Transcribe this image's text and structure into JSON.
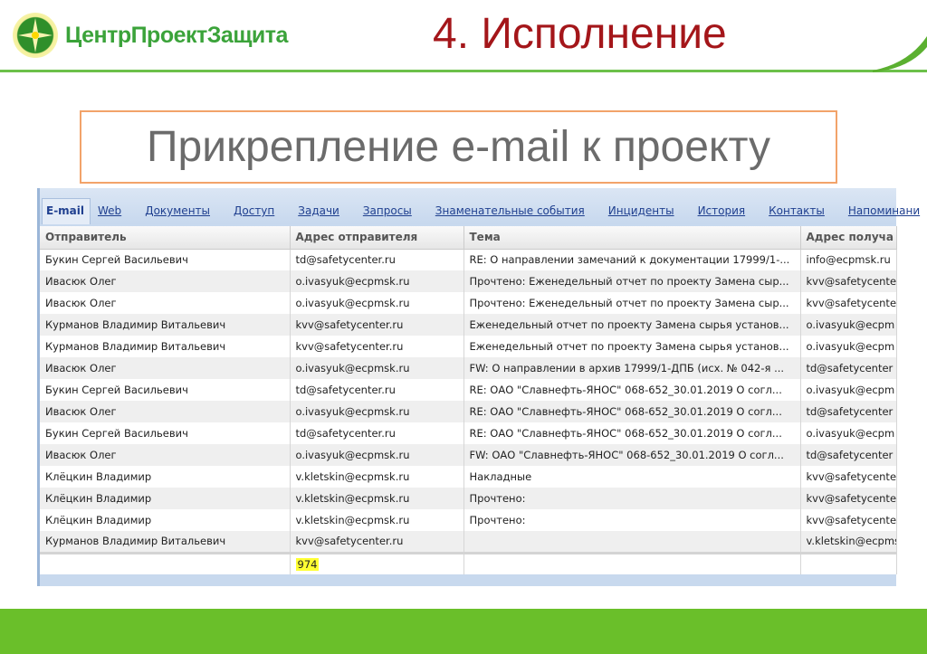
{
  "header": {
    "logo_text": "ЦентрПроектЗащита",
    "slide_title": "4. Исполнение"
  },
  "subtitle": "Прикрепление e-mail к проекту",
  "tabs": [
    "E-mail",
    "Web",
    "Документы",
    "Доступ",
    "Задачи",
    "Запросы",
    "Знаменательные события",
    "Инциденты",
    "История",
    "Контакты",
    "Напоминани"
  ],
  "active_tab": 0,
  "columns": [
    "Отправитель",
    "Адрес отправителя",
    "Тема",
    "Адрес получа"
  ],
  "rows": [
    [
      "Букин Сергей Васильевич",
      "td@safetycenter.ru",
      "RE: О направлении замечаний к документации 17999/1-...",
      "info@ecpmsk.ru"
    ],
    [
      "Ивасюк Олег",
      "o.ivasyuk@ecpmsk.ru",
      "Прочтено: Еженедельный отчет по проекту Замена сыр...",
      "kvv@safetycente"
    ],
    [
      "Ивасюк Олег",
      "o.ivasyuk@ecpmsk.ru",
      "Прочтено: Еженедельный отчет по проекту Замена сыр...",
      "kvv@safetycente"
    ],
    [
      "Курманов Владимир Витальевич",
      "kvv@safetycenter.ru",
      "Еженедельный отчет по проекту Замена сырья установ...",
      "o.ivasyuk@ecpm"
    ],
    [
      "Курманов Владимир Витальевич",
      "kvv@safetycenter.ru",
      "Еженедельный отчет по проекту Замена сырья установ...",
      "o.ivasyuk@ecpm"
    ],
    [
      "Ивасюк Олег",
      "o.ivasyuk@ecpmsk.ru",
      "FW: О направлении в архив 17999/1-ДПБ (исх. № 042-я ...",
      "td@safetycenter"
    ],
    [
      "Букин Сергей Васильевич",
      "td@safetycenter.ru",
      "RE: ОАО \"Славнефть-ЯНОС\" 068-652_30.01.2019 О согл...",
      "o.ivasyuk@ecpm"
    ],
    [
      "Ивасюк Олег",
      "o.ivasyuk@ecpmsk.ru",
      "RE: ОАО \"Славнефть-ЯНОС\" 068-652_30.01.2019 О согл...",
      "td@safetycenter"
    ],
    [
      "Букин Сергей Васильевич",
      "td@safetycenter.ru",
      "RE: ОАО \"Славнефть-ЯНОС\" 068-652_30.01.2019 О согл...",
      "o.ivasyuk@ecpm"
    ],
    [
      "Ивасюк Олег",
      "o.ivasyuk@ecpmsk.ru",
      "FW: ОАО \"Славнефть-ЯНОС\" 068-652_30.01.2019 О согл...",
      "td@safetycenter"
    ],
    [
      "Клёцкин Владимир",
      "v.kletskin@ecpmsk.ru",
      "Накладные",
      "kvv@safetycente"
    ],
    [
      "Клёцкин Владимир",
      "v.kletskin@ecpmsk.ru",
      "Прочтено:",
      "kvv@safetycente"
    ],
    [
      "Клёцкин Владимир",
      "v.kletskin@ecpmsk.ru",
      "Прочтено:",
      "kvv@safetycente"
    ],
    [
      "Курманов Владимир Витальевич",
      "kvv@safetycenter.ru",
      "",
      "v.kletskin@ecpms"
    ]
  ],
  "total_count": "974",
  "colors": {
    "brand_green": "#3ba33a",
    "title_red": "#a4161a",
    "band_green": "#6abf2a",
    "box_border": "#f2a36a"
  }
}
